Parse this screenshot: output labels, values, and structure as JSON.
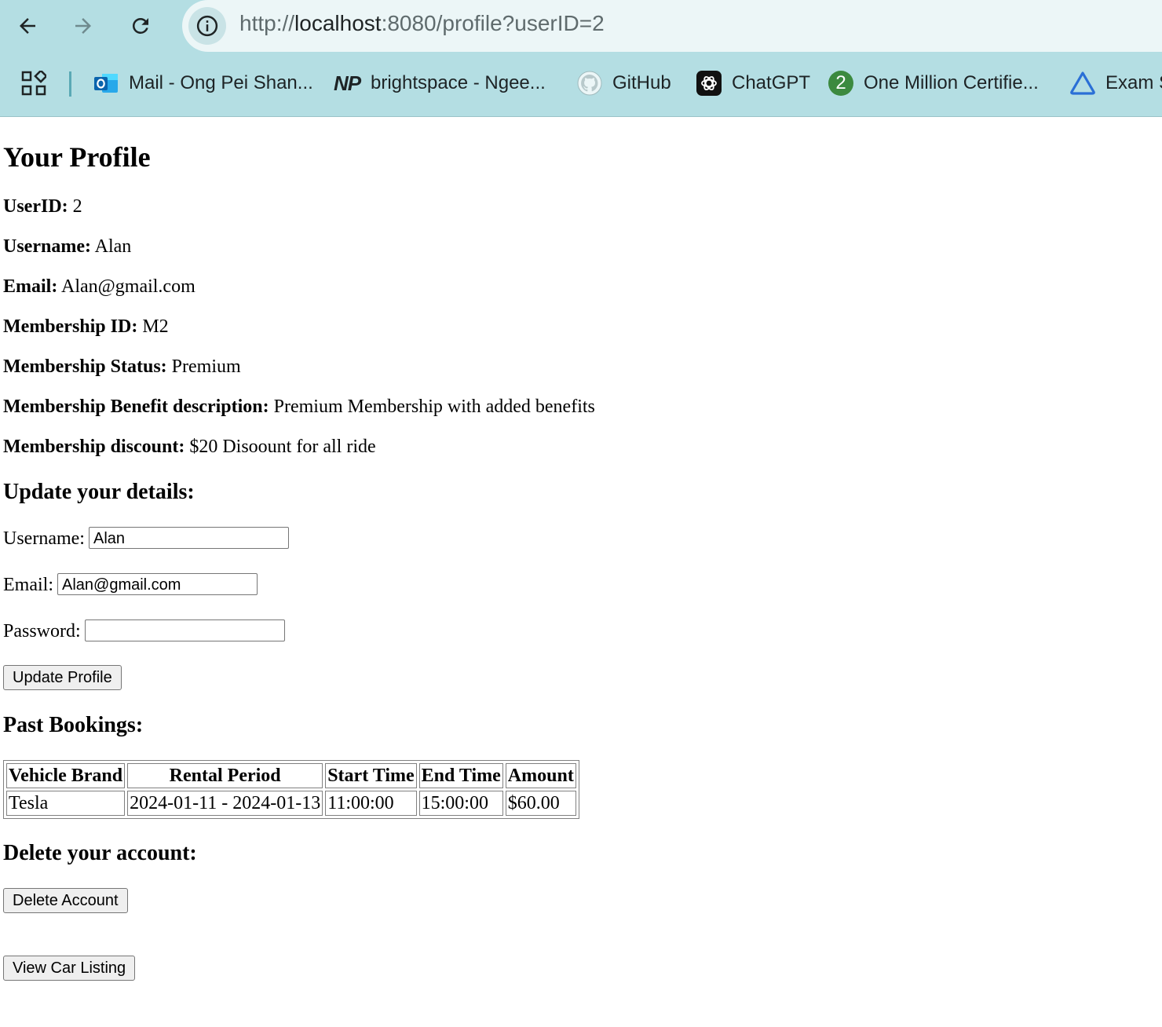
{
  "browser": {
    "url_scheme": "http://",
    "url_host": "localhost",
    "url_rest": ":8080/profile?userID=2",
    "bookmarks": [
      {
        "label": "Mail - Ong Pei Shan...",
        "icon": "outlook-icon"
      },
      {
        "label": "brightspace - Ngee...",
        "icon": "np-logo-icon"
      },
      {
        "label": "GitHub",
        "icon": "github-icon"
      },
      {
        "label": "ChatGPT",
        "icon": "chatgpt-icon"
      },
      {
        "label": "One Million Certifie...",
        "icon": "number-two-icon"
      },
      {
        "label": "Exam S",
        "icon": "exam-triangle-icon"
      }
    ],
    "np_icon_text": "NP",
    "two_icon_text": "2"
  },
  "profile": {
    "title": "Your Profile",
    "fields": [
      {
        "label": "UserID:",
        "value": "2"
      },
      {
        "label": "Username:",
        "value": "Alan"
      },
      {
        "label": "Email:",
        "value": "Alan@gmail.com"
      },
      {
        "label": "Membership ID:",
        "value": "M2"
      },
      {
        "label": "Membership Status:",
        "value": "Premium"
      },
      {
        "label": "Membership Benefit description:",
        "value": "Premium Membership with added benefits"
      },
      {
        "label": "Membership discount:",
        "value": "$20 Disoount for all ride"
      }
    ]
  },
  "update": {
    "heading": "Update your details:",
    "username_label": "Username:",
    "username_value": "Alan",
    "email_label": "Email:",
    "email_value": "Alan@gmail.com",
    "password_label": "Password:",
    "password_value": "",
    "submit_label": "Update Profile"
  },
  "bookings": {
    "heading": "Past Bookings:",
    "columns": [
      "Vehicle Brand",
      "Rental Period",
      "Start Time",
      "End Time",
      "Amount"
    ],
    "rows": [
      [
        "Tesla",
        "2024-01-11 - 2024-01-13",
        "11:00:00",
        "15:00:00",
        "$60.00"
      ]
    ]
  },
  "delete": {
    "heading": "Delete your account:",
    "button_label": "Delete Account"
  },
  "listing": {
    "button_label": "View Car Listing"
  },
  "colors": {
    "chrome_bg": "#b4dee3",
    "omnibox_bg": "#ecf6f7"
  }
}
